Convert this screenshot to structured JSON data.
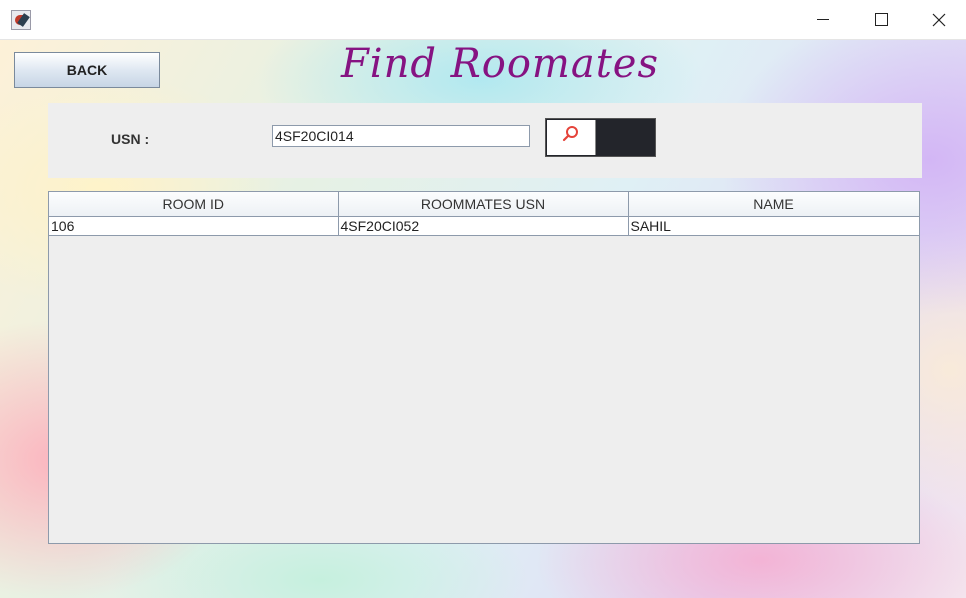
{
  "window": {
    "title": "",
    "controls": [
      "minimize",
      "maximize",
      "close"
    ]
  },
  "header": {
    "back_label": "BACK",
    "title": "Find Roomates",
    "title_color": "#861382"
  },
  "search": {
    "usn_label": "USN :",
    "usn_value": "4SF20CI014",
    "button_icon": "search-icon"
  },
  "table": {
    "columns": [
      "ROOM ID",
      "ROOMMATES USN",
      "NAME"
    ],
    "rows": [
      [
        "106",
        "4SF20CI052",
        "SAHIL"
      ]
    ]
  }
}
